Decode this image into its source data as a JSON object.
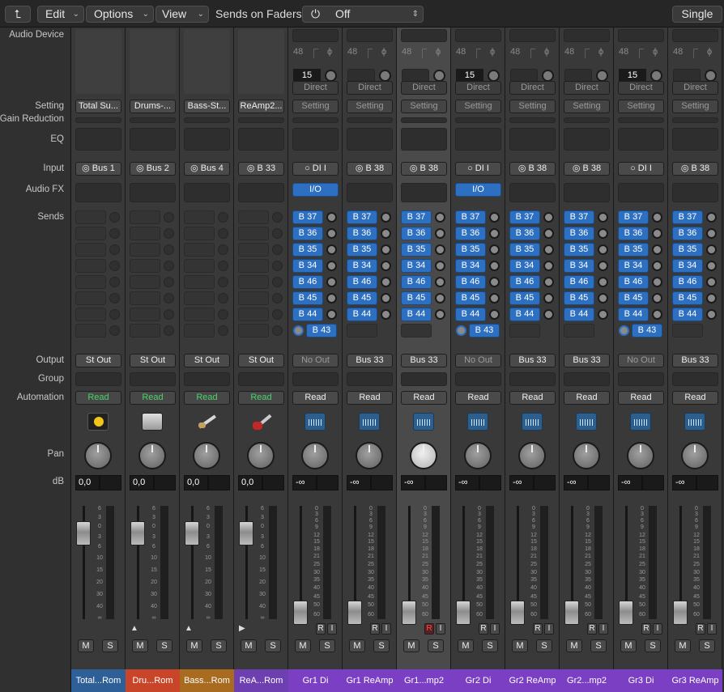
{
  "toolbar": {
    "back_icon": "back-arrow-icon",
    "edit_label": "Edit",
    "options_label": "Options",
    "view_label": "View",
    "sends_on_faders_label": "Sends on Faders:",
    "sends_on_faders_value": "Off",
    "single_label": "Single"
  },
  "row_labels": {
    "audio_device": "Audio Device",
    "setting": "Setting",
    "gain_reduction": "Gain Reduction",
    "eq": "EQ",
    "input": "Input",
    "audio_fx": "Audio FX",
    "sends": "Sends",
    "output": "Output",
    "group": "Group",
    "automation": "Automation",
    "pan": "Pan",
    "db": "dB"
  },
  "scale_labels": [
    "6",
    "3",
    "0",
    "3",
    "6",
    "10",
    "15",
    "20",
    "30",
    "40",
    "∞"
  ],
  "meter_labels": [
    "0",
    "3",
    "6",
    "9",
    "12",
    "15",
    "18",
    "21",
    "25",
    "30",
    "35",
    "40",
    "45",
    "50",
    "60"
  ],
  "channel_strip_labels": {
    "sample_rate": "48",
    "direct": "Direct",
    "mute": "M",
    "solo": "S",
    "rec": "R",
    "input_monitor": "I"
  },
  "sends_list": [
    "B 37",
    "B 36",
    "B 35",
    "B 34",
    "B 46",
    "B 45",
    "B 44",
    "B 43"
  ],
  "strips": [
    {
      "setting": "Total Su...",
      "input": "Bus 1",
      "output": "St Out",
      "automation": "Read",
      "db": "0,0",
      "name": "Total...Rom",
      "name_color": "#2f5f97",
      "icon": "yellow-clock-icon",
      "has_sends": false,
      "fader_level": 0.0,
      "fx": ""
    },
    {
      "setting": "Drums-...",
      "input": "Bus 2",
      "output": "St Out",
      "automation": "Read",
      "db": "0,0",
      "name": "Dru...Rom",
      "name_color": "#c8452a",
      "icon": "drum-machine-icon",
      "has_sends": false,
      "fader_level": 0.0,
      "fx": "",
      "marker": "▲"
    },
    {
      "setting": "Bass-St...",
      "input": "Bus 4",
      "output": "St Out",
      "automation": "Read",
      "db": "0,0",
      "name": "Bass...Rom",
      "name_color": "#a86b1f",
      "icon": "bass-guitar-icon",
      "has_sends": false,
      "fader_level": 0.0,
      "fx": "",
      "marker": "▲"
    },
    {
      "setting": "ReAmp2...",
      "input": "B 33",
      "output": "St Out",
      "automation": "Read",
      "db": "0,0",
      "name": "ReA...Rom",
      "name_color": "#6e3fb0",
      "icon": "electric-guitar-icon",
      "has_sends": false,
      "fader_level": 0.0,
      "fx": "",
      "marker": "▶"
    },
    {
      "setting": "Setting",
      "input": "DI I",
      "output": "No Out",
      "automation": "Read",
      "db": "-∞",
      "name": "Gr1 Di",
      "name_color": "#7b3fc4",
      "icon": "audio-waveform-icon",
      "has_sends": true,
      "fader_level": -1,
      "fx": "I/O",
      "chan": "15",
      "ri": true
    },
    {
      "setting": "Setting",
      "input": "B 38",
      "output": "Bus 33",
      "automation": "Read",
      "db": "-∞",
      "name": "Gr1 ReAmp",
      "name_color": "#7b3fc4",
      "icon": "audio-waveform-icon",
      "has_sends": true,
      "fader_level": -1,
      "fx": "",
      "ri": true
    },
    {
      "setting": "Setting",
      "input": "B 38",
      "output": "Bus 33",
      "automation": "Read",
      "db": "-∞",
      "name": "Gr1...mp2",
      "name_color": "#7b3fc4",
      "icon": "audio-waveform-icon",
      "has_sends": true,
      "fader_level": -1,
      "fx": "",
      "ri": true,
      "rec_armed": true,
      "selected": true
    },
    {
      "setting": "Setting",
      "input": "DI I",
      "output": "No Out",
      "automation": "Read",
      "db": "-∞",
      "name": "Gr2 Di",
      "name_color": "#7b3fc4",
      "icon": "audio-waveform-icon",
      "has_sends": true,
      "fader_level": -1,
      "fx": "I/O",
      "chan": "15",
      "ri": true
    },
    {
      "setting": "Setting",
      "input": "B 38",
      "output": "Bus 33",
      "automation": "Read",
      "db": "-∞",
      "name": "Gr2 ReAmp",
      "name_color": "#7b3fc4",
      "icon": "audio-waveform-icon",
      "has_sends": true,
      "fader_level": -1,
      "fx": "",
      "ri": true
    },
    {
      "setting": "Setting",
      "input": "B 38",
      "output": "Bus 33",
      "automation": "Read",
      "db": "-∞",
      "name": "Gr2...mp2",
      "name_color": "#7b3fc4",
      "icon": "audio-waveform-icon",
      "has_sends": true,
      "fader_level": -1,
      "fx": "",
      "ri": true
    },
    {
      "setting": "Setting",
      "input": "DI I",
      "output": "No Out",
      "automation": "Read",
      "db": "-∞",
      "name": "Gr3 Di",
      "name_color": "#7b3fc4",
      "icon": "audio-waveform-icon",
      "has_sends": true,
      "fader_level": -1,
      "fx": "",
      "chan": "15",
      "ri": true
    },
    {
      "setting": "Setting",
      "input": "B 38",
      "output": "Bus 33",
      "automation": "Read",
      "db": "-∞",
      "name": "Gr3 ReAmp",
      "name_color": "#7b3fc4",
      "icon": "audio-waveform-icon",
      "has_sends": true,
      "fader_level": -1,
      "fx": "",
      "ri": true
    }
  ]
}
